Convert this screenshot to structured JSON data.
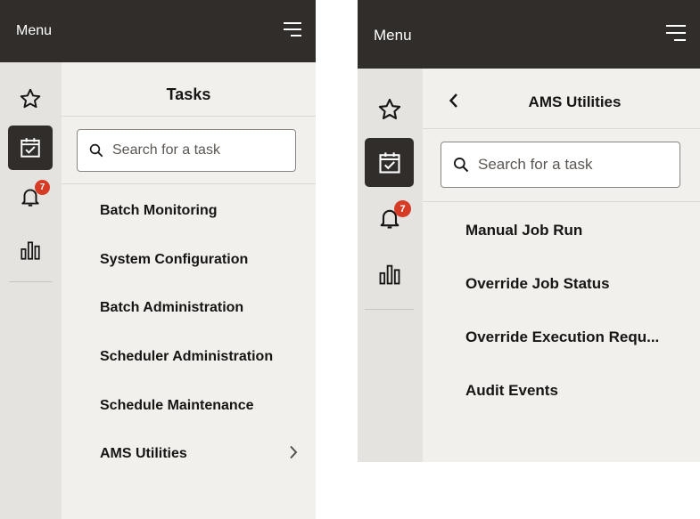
{
  "panel1": {
    "header": {
      "title": "Menu"
    },
    "rail": {
      "notification_count": "7"
    },
    "content": {
      "title": "Tasks",
      "search": {
        "placeholder": "Search for a task"
      },
      "items": [
        {
          "label": "Batch Monitoring"
        },
        {
          "label": "System Configuration"
        },
        {
          "label": "Batch Administration"
        },
        {
          "label": "Scheduler Administration"
        },
        {
          "label": "Schedule Maintenance"
        },
        {
          "label": "AMS Utilities"
        }
      ]
    }
  },
  "panel2": {
    "header": {
      "title": "Menu"
    },
    "rail": {
      "notification_count": "7"
    },
    "content": {
      "title": "AMS Utilities",
      "search": {
        "placeholder": "Search for a task"
      },
      "items": [
        {
          "label": "Manual Job Run"
        },
        {
          "label": "Override Job Status"
        },
        {
          "label": "Override Execution Requ..."
        },
        {
          "label": "Audit Events"
        }
      ]
    }
  },
  "colors": {
    "header_bg": "#312d2a",
    "rail_bg": "#e5e3e0",
    "content_bg": "#f2f0ed",
    "badge": "#d63b25"
  },
  "icons": [
    "hamburger-icon",
    "star-icon",
    "calendar-check-icon",
    "bell-icon",
    "bar-chart-icon",
    "search-icon",
    "chevron-left-icon",
    "chevron-right-icon"
  ]
}
